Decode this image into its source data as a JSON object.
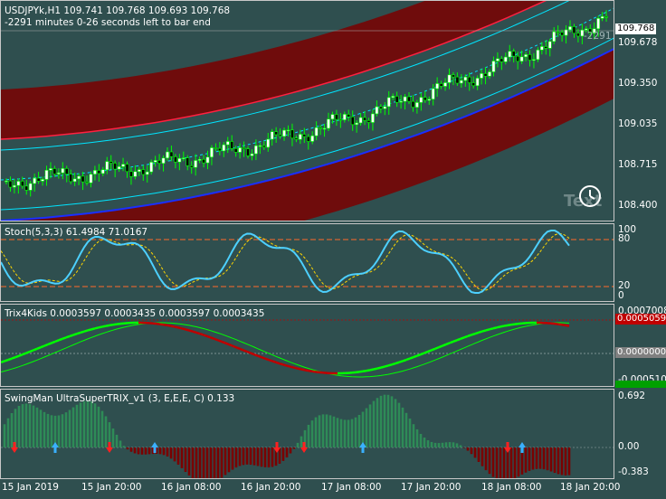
{
  "colors": {
    "background": "#2f4f4f",
    "bull_candle": "#ffffff",
    "bear_candle": "#000000",
    "wick": "#00ff00",
    "channel_line": "#00e5ff",
    "channel_band": "#7a0000",
    "stoch_main": "#4dd0ff",
    "stoch_signal": "#ffd700",
    "trix_up": "#00ff00",
    "trix_down": "#c00000",
    "hist_up": "#2e8b57",
    "hist_down": "#7a0000",
    "level_line": "#ff6a2a"
  },
  "main": {
    "symbol_line": "USDJPYk,H1  109.741 109.768 109.693 109.768",
    "countdown": "-2291 minutes 0-26 seconds left to bar end",
    "inline_countdown": "-2291",
    "watermark": "Text",
    "current_price": "109.768",
    "price_labels": [
      "109.678",
      "109.350",
      "109.035",
      "108.715",
      "108.400"
    ],
    "clock_icon": "clock-icon"
  },
  "stoch": {
    "title": "Stoch(5,3,3) 61.4984 71.0167",
    "levels": [
      "100",
      "80",
      "20",
      "0"
    ]
  },
  "trix": {
    "title": "Trix4Kids 0.0003597 0.0003435 0.0003597 0.0003435",
    "labels": [
      "0.0007008",
      "0.0005059",
      "0.0000000",
      "-0.0005107"
    ]
  },
  "swing": {
    "title": "SwingMan UltraSuperTRIX_v1 (3, E,E,E, C) 0.133",
    "labels": [
      "0.692",
      "0.00",
      "-0.383"
    ]
  },
  "time_axis": [
    "15 Jan 2019",
    "15 Jan 20:00",
    "16 Jan 08:00",
    "16 Jan 20:00",
    "17 Jan 08:00",
    "17 Jan 20:00",
    "18 Jan 08:00",
    "18 Jan 20:00"
  ]
}
